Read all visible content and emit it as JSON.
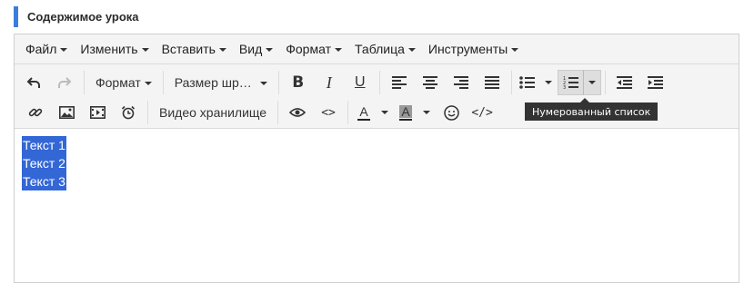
{
  "section": {
    "title": "Содержимое урока"
  },
  "menubar": {
    "items": [
      {
        "label": "Файл"
      },
      {
        "label": "Изменить"
      },
      {
        "label": "Вставить"
      },
      {
        "label": "Вид"
      },
      {
        "label": "Формат"
      },
      {
        "label": "Таблица"
      },
      {
        "label": "Инструменты"
      }
    ]
  },
  "toolbar": {
    "format_label": "Формат",
    "font_size_label": "Размер шр…",
    "bold_label": "B",
    "italic_label": "I",
    "underline_label": "U",
    "text_color_label": "A",
    "bg_color_label": "A",
    "video_storage_label": "Видео хранилище",
    "code_label": "</>",
    "source_label": "<>",
    "icons": [
      "undo-icon",
      "redo-icon",
      "align-left-icon",
      "align-center-icon",
      "align-right-icon",
      "align-justify-icon",
      "bullet-list-icon",
      "numbered-list-icon",
      "outdent-icon",
      "indent-icon",
      "link-icon",
      "image-icon",
      "media-icon",
      "alarm-clock-icon",
      "preview-eye-icon",
      "emoji-icon"
    ],
    "active_button": "numbered-list",
    "tooltip": "Нумерованный список"
  },
  "content": {
    "lines": [
      "Текст 1",
      "Текст 2",
      "Текст 3"
    ],
    "selection_color": "#3367d6"
  },
  "colors": {
    "accent": "#3b7ddd",
    "toolbar_bg": "#f4f4f4"
  }
}
